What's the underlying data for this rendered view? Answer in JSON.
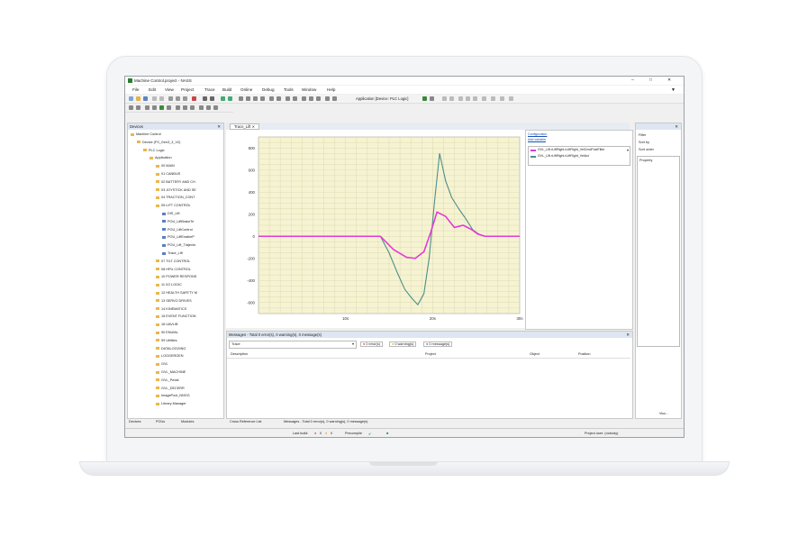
{
  "window": {
    "title": "Machine Control.project - NASS",
    "controls": [
      "–",
      "□",
      "✕"
    ]
  },
  "menu": [
    "File",
    "Edit",
    "View",
    "Project",
    "Trace",
    "Build",
    "Online",
    "Debug",
    "Tools",
    "Window",
    "Help"
  ],
  "toolbar": {
    "application_label": "Application [Device: PLC Logic]"
  },
  "devices_panel": {
    "title": "Devices",
    "tree": [
      {
        "label": "Machine Control",
        "level": 0
      },
      {
        "label": "Device (FS_Gen3_3_V2)",
        "level": 1
      },
      {
        "label": "PLC Logic",
        "level": 2
      },
      {
        "label": "Application",
        "level": 3
      },
      {
        "label": "00 MAIN",
        "level": 4
      },
      {
        "label": "01 CANBUS",
        "level": 4
      },
      {
        "label": "02 BATTERY AND CH",
        "level": 4
      },
      {
        "label": "03 JOYSTICK AND SE",
        "level": 4
      },
      {
        "label": "04 TRACTION_CONT",
        "level": 4
      },
      {
        "label": "05 LIFT CONTROL",
        "level": 4
      },
      {
        "label": "DIS_Lift",
        "level": 5
      },
      {
        "label": "POU_LiftBrakeTe",
        "level": 5
      },
      {
        "label": "POU_LiftControl",
        "level": 5
      },
      {
        "label": "POU_LiftEnableP",
        "level": 5
      },
      {
        "label": "POU_Lift_Trajecto",
        "level": 5
      },
      {
        "label": "Trace_Lift",
        "level": 5
      },
      {
        "label": "07 TILT CONTROL",
        "level": 4
      },
      {
        "label": "08 HPU CONTROL",
        "level": 4
      },
      {
        "label": "10 POWER RESPONS",
        "level": 4
      },
      {
        "label": "11 I/O LOGIC",
        "level": 4
      },
      {
        "label": "12 HEALTH SAFETY M",
        "level": 4
      },
      {
        "label": "13 SERVO DRIVES",
        "level": 4
      },
      {
        "label": "14 KINEMATICS",
        "level": 4
      },
      {
        "label": "15 EVENT FUNCTION",
        "level": 4
      },
      {
        "label": "16 UAVLIB",
        "level": 4
      },
      {
        "label": "90 ENUMs",
        "level": 4
      },
      {
        "label": "99 Utilities",
        "level": 4
      },
      {
        "label": "DATALOGGING",
        "level": 4
      },
      {
        "label": "LOGGERGEN",
        "level": 4
      },
      {
        "label": "GVL",
        "level": 4
      },
      {
        "label": "GVL_MACHINE",
        "level": 4
      },
      {
        "label": "GVL_Pedal",
        "level": 4
      },
      {
        "label": "GVL_DECERR",
        "level": 4
      },
      {
        "label": "ImagePool_NNGG",
        "level": 4
      },
      {
        "label": "Library Manager",
        "level": 4
      }
    ],
    "bottom_tabs": [
      "Devices",
      "POUs",
      "Modules"
    ]
  },
  "editor": {
    "tab": "Trace_Lift",
    "links": [
      "Configuration",
      "Add variable"
    ],
    "legend": [
      {
        "name": "GVL_Lift.rLiftRight.rLiftRight_VelCmdPostFilter",
        "color": "#e33ad6"
      },
      {
        "name": "GVL_Lift.rLiftRight.rLiftRight_VelAct",
        "color": "#4c8f8a"
      }
    ]
  },
  "chart_data": {
    "type": "line",
    "title": "",
    "xlabel": "",
    "ylabel": "",
    "x_ticks": [
      "10s",
      "20s",
      "30s"
    ],
    "y_ticks": [
      800,
      600,
      400,
      200,
      0,
      -200,
      -400,
      -600
    ],
    "xlim": [
      0,
      30
    ],
    "ylim": [
      -700,
      900
    ],
    "grid": true,
    "series": [
      {
        "name": "GVL_Lift.rLiftRight.rLiftRight_VelCmdPostFilter",
        "x": [
          0,
          14.0,
          15.5,
          17.0,
          18.0,
          19.0,
          19.8,
          20.5,
          21.5,
          22.5,
          23.5,
          24.5,
          25.2,
          26.0,
          30.0
        ],
        "y": [
          0,
          0,
          -120,
          -190,
          -200,
          -140,
          40,
          220,
          180,
          80,
          100,
          60,
          20,
          0,
          0
        ]
      },
      {
        "name": "GVL_Lift.rLiftRight.rLiftRight_VelAct",
        "x": [
          0,
          14.0,
          15.0,
          16.0,
          16.8,
          17.6,
          18.3,
          19.0,
          19.6,
          20.2,
          20.8,
          21.5,
          22.2,
          23.0,
          23.8,
          24.6,
          25.3,
          26.0,
          30.0
        ],
        "y": [
          0,
          0,
          -150,
          -340,
          -480,
          -560,
          -620,
          -520,
          -200,
          300,
          750,
          500,
          350,
          250,
          160,
          60,
          20,
          0,
          0
        ]
      }
    ]
  },
  "messages_panel": {
    "title": "Messages - Total 0 error(s), 0 warning(s), 0 message(s)",
    "filter": "Trace",
    "badges": [
      "0 error(s)",
      "0 warning(s)",
      "0 message(s)"
    ],
    "columns": [
      "Description",
      "Project",
      "Object",
      "Position"
    ]
  },
  "bottom_tabs": [
    "Cross Reference List",
    "Messages - Total 0 error(s), 0 warning(s), 0 message(s)"
  ],
  "properties_panel": {
    "buttons": [
      "Filter",
      "Sort by",
      "Sort order"
    ],
    "header": "Property",
    "bottom_tab": "Visu..."
  },
  "status": {
    "last_build": "Last build:",
    "errors": "0",
    "warnings": "0",
    "precompile": "Precompile",
    "user": "Project user: (nobody)"
  }
}
